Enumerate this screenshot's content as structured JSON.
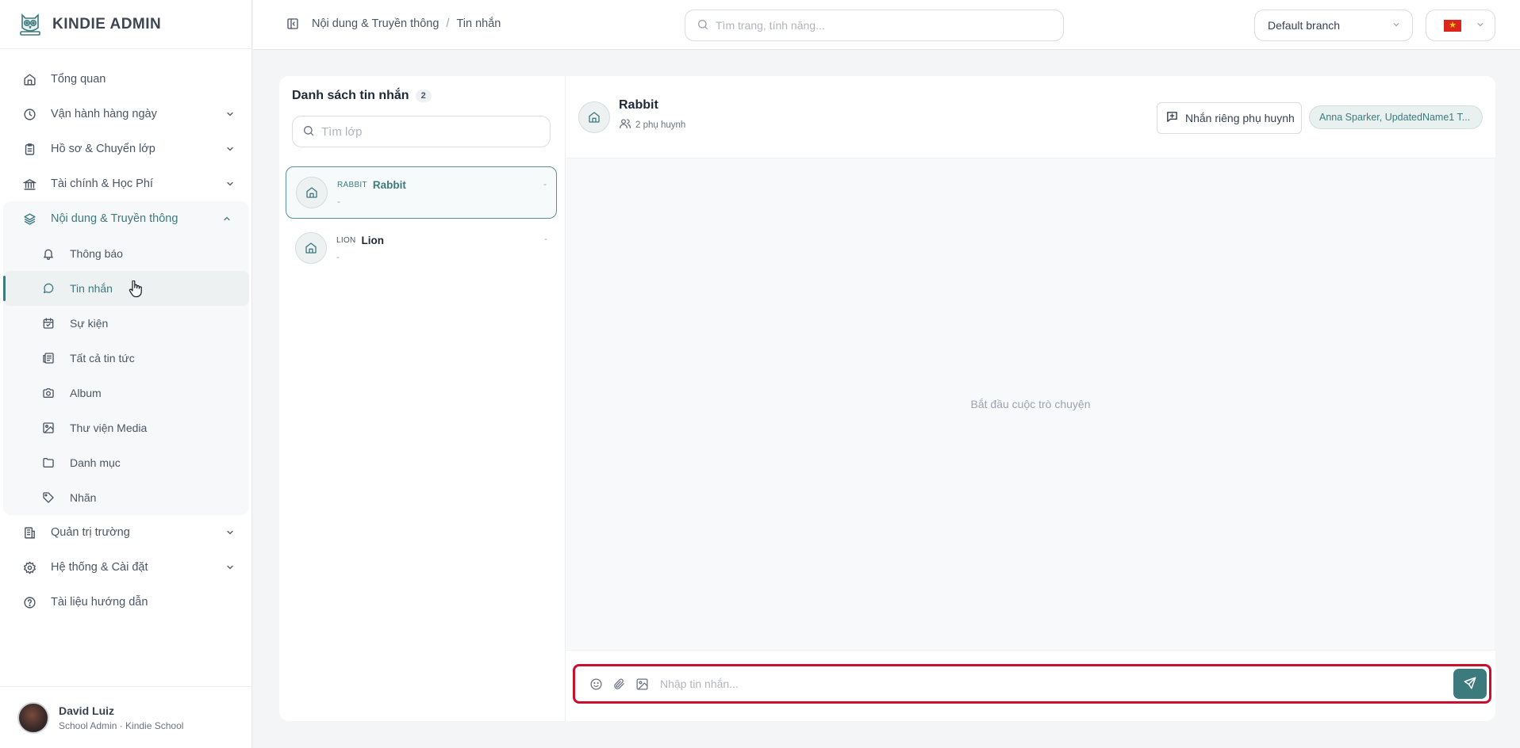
{
  "brand": {
    "name": "KINDIE ADMIN"
  },
  "sidebar": {
    "items": [
      {
        "label": "Tổng quan",
        "icon": "home-icon",
        "has_chevron": false
      },
      {
        "label": "Vận hành hàng ngày",
        "icon": "clock-icon",
        "has_chevron": true
      },
      {
        "label": "Hồ sơ & Chuyển lớp",
        "icon": "clipboard-icon",
        "has_chevron": true
      },
      {
        "label": "Tài chính & Học Phí",
        "icon": "bank-icon",
        "has_chevron": true
      },
      {
        "label": "Nội dung & Truyền thông",
        "icon": "layers-icon",
        "has_chevron": true,
        "expanded": true
      }
    ],
    "subitems": [
      {
        "label": "Thông báo",
        "icon": "bell-icon"
      },
      {
        "label": "Tin nhắn",
        "icon": "message-circle-icon",
        "active": true
      },
      {
        "label": "Sự kiện",
        "icon": "calendar-check-icon"
      },
      {
        "label": "Tất cả tin tức",
        "icon": "newspaper-icon"
      },
      {
        "label": "Album",
        "icon": "camera-icon"
      },
      {
        "label": "Thư viện Media",
        "icon": "image-icon"
      },
      {
        "label": "Danh mục",
        "icon": "folder-icon"
      },
      {
        "label": "Nhãn",
        "icon": "tag-icon"
      }
    ],
    "items_after": [
      {
        "label": "Quản trị trường",
        "icon": "building-icon",
        "has_chevron": true
      },
      {
        "label": "Hệ thống & Cài đặt",
        "icon": "gear-icon",
        "has_chevron": true
      },
      {
        "label": "Tài liệu hướng dẫn",
        "icon": "help-circle-icon",
        "has_chevron": false
      }
    ]
  },
  "user": {
    "name": "David Luiz",
    "role": "School Admin · Kindie School"
  },
  "topbar": {
    "breadcrumb": [
      "Nội dung & Truyền thông",
      "Tin nhắn"
    ],
    "search_placeholder": "Tìm trang, tính năng...",
    "branch": "Default branch",
    "language_flag": "vn-flag"
  },
  "message_list": {
    "title": "Danh sách tin nhắn",
    "count": "2",
    "search_placeholder": "Tìm lớp",
    "conversations": [
      {
        "code": "RABBIT",
        "name": "Rabbit",
        "last": "-",
        "time": "-",
        "selected": true
      },
      {
        "code": "LION",
        "name": "Lion",
        "last": "-",
        "time": "-",
        "selected": false
      }
    ]
  },
  "chat": {
    "title": "Rabbit",
    "subtitle": "2 phụ huynh",
    "private_button": "Nhắn riêng phụ huynh",
    "members": "Anna Sparker, UpdatedName1 T...",
    "empty_text": "Bắt đầu cuộc trò chuyện",
    "input_placeholder": "Nhập tin nhắn..."
  },
  "colors": {
    "accent": "#3d7a7e",
    "highlight_border": "#c8102e"
  }
}
